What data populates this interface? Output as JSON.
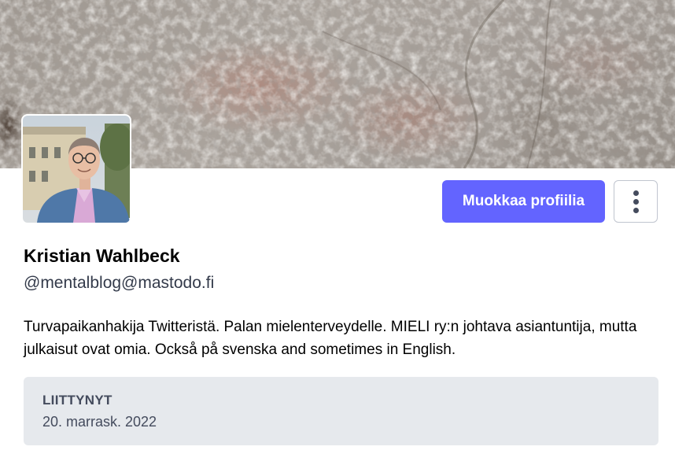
{
  "profile": {
    "display_name": "Kristian Wahlbeck",
    "handle": "@mentalblog@mastodo.fi",
    "bio": "Turvapaikanhakija Twitteristä. Palan mielenterveydelle. MIELI ry:n johtava asiantuntija, mutta julkaisut ovat omia. Också på svenska and sometimes in English.",
    "avatar_alt": "Kristian Wahlbeck",
    "header_image": "textured-rock-header"
  },
  "actions": {
    "edit_profile_label": "Muokkaa profiilia",
    "menu_icon": "vertical-ellipsis-icon"
  },
  "joined": {
    "label": "LIITTYNYT",
    "date": "20. marrask. 2022"
  },
  "colors": {
    "accent": "#6364ff",
    "joined_background": "#e6e9ed",
    "muted_text": "#444b5d"
  }
}
